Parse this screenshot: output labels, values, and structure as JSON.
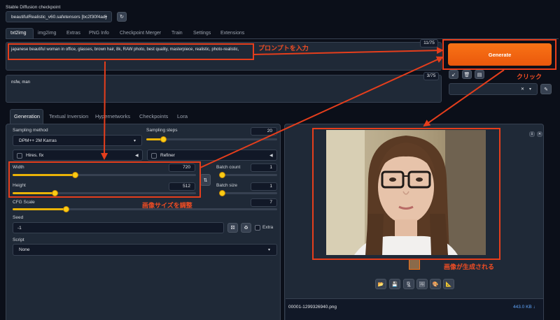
{
  "checkpoint": {
    "label": "Stable Diffusion checkpoint",
    "value": "beautifulRealistic_v60.safetensors [bc2f30f4ad]"
  },
  "top_tabs": [
    "txt2img",
    "img2img",
    "Extras",
    "PNG Info",
    "Checkpoint Merger",
    "Train",
    "Settings",
    "Extensions"
  ],
  "prompt": {
    "text": "japanese beautiful woman in office, glasses, brown hair, 8k, RAW photo, best quality, masterpiece, realistic, photo-realistic,",
    "count": "11/75"
  },
  "negative_prompt": {
    "text": "nsfw, man",
    "count": "3/75"
  },
  "generate_label": "Generate",
  "sub_tabs": [
    "Generation",
    "Textual Inversion",
    "Hypernetworks",
    "Checkpoints",
    "Lora"
  ],
  "sampling_method": {
    "label": "Sampling method",
    "value": "DPM++ 2M Karras"
  },
  "sampling_steps": {
    "label": "Sampling steps",
    "value": "20",
    "fraction": 0.13
  },
  "hires_label": "Hires. fix",
  "refiner_label": "Refiner",
  "width": {
    "label": "Width",
    "value": "720",
    "fraction": 0.34
  },
  "height": {
    "label": "Height",
    "value": "512",
    "fraction": 0.23
  },
  "batch_count": {
    "label": "Batch count",
    "value": "1",
    "fraction": 0.0
  },
  "batch_size": {
    "label": "Batch size",
    "value": "1",
    "fraction": 0.0
  },
  "cfg_scale": {
    "label": "CFG Scale",
    "value": "7",
    "fraction": 0.2
  },
  "seed": {
    "label": "Seed",
    "value": "-1",
    "extra_label": "Extra"
  },
  "script": {
    "label": "Script",
    "value": "None"
  },
  "output": {
    "filename": "00001-1299326940.png",
    "filesize": "443.0 KB ↓"
  },
  "annotations": {
    "prompt_input": "プロンプトを入力",
    "click": "クリック",
    "adjust_size": "画像サイズを調整",
    "generated": "画像が生成される"
  },
  "colors": {
    "accent_orange": "#f97316",
    "annotation_red": "#e53e1c",
    "slider_yellow": "#eab308",
    "background": "#0b0f19"
  }
}
